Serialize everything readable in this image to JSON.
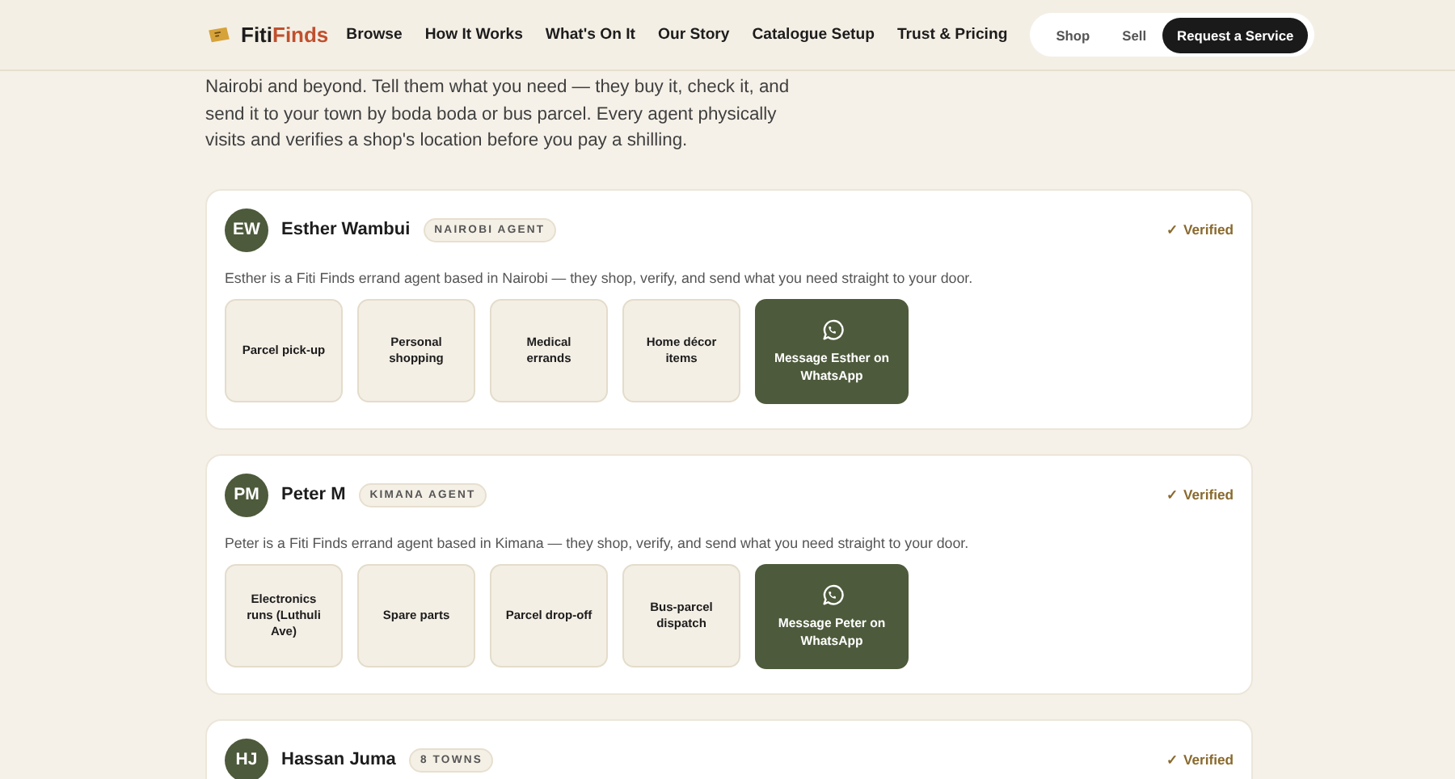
{
  "header": {
    "brand": {
      "first": "Fiti",
      "second": "Finds"
    },
    "nav": [
      {
        "label": "Browse"
      },
      {
        "label": "How It Works"
      },
      {
        "label": "What's On It"
      },
      {
        "label": "Our Story"
      },
      {
        "label": "Catalogue Setup"
      },
      {
        "label": "Trust & Pricing"
      }
    ],
    "pill": [
      {
        "label": "Shop",
        "kind": "link"
      },
      {
        "label": "Sell",
        "kind": "link"
      },
      {
        "label": "Request a Service",
        "kind": "primary"
      }
    ]
  },
  "intro": "Nairobi and beyond. Tell them what you need — they buy it, check it, and send it to your town by boda boda or bus parcel. Every agent physically visits and verifies a shop's location before you pay a shilling.",
  "agents": [
    {
      "initials": "EW",
      "name": "Esther Wambui",
      "badge": "NAIROBI AGENT",
      "verified": "✓ Verified",
      "description": "Esther is a Fiti Finds errand agent based in Nairobi — they shop, verify, and send what you need straight to your door.",
      "services": [
        "Parcel pick-up",
        "Personal shopping",
        "Medical errands",
        "Home décor items"
      ],
      "message": "Message Esther on WhatsApp"
    },
    {
      "initials": "PM",
      "name": "Peter M",
      "badge": "KIMANA AGENT",
      "verified": "✓ Verified",
      "description": "Peter is a Fiti Finds errand agent based in Kimana — they shop, verify, and send what you need straight to your door.",
      "services": [
        "Electronics runs (Luthuli Ave)",
        "Spare parts",
        "Parcel drop-off",
        "Bus-parcel dispatch"
      ],
      "message": "Message Peter on WhatsApp"
    },
    {
      "initials": "HJ",
      "name": "Hassan Juma",
      "badge": "8 TOWNS",
      "verified": "✓ Verified"
    }
  ]
}
